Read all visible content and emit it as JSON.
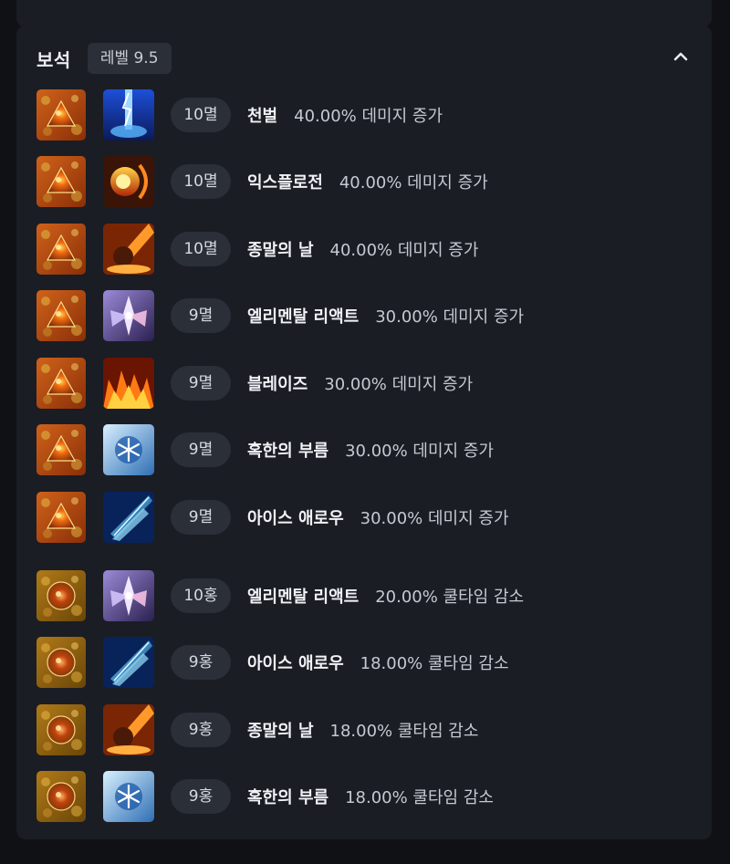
{
  "section": {
    "title": "보석",
    "level_badge": "레벨 9.5",
    "collapse_icon": "chevron-up-icon"
  },
  "colors": {
    "panel": "#1a1d24",
    "pill": "#2b2f38",
    "gem_damage_bg": "#b4490f",
    "gem_cooldown_bg": "#8a5a0a"
  },
  "gems": [
    {
      "gem_type": "damage-gem",
      "skill_icon": "judgment-lightning-icon",
      "level": "10멸",
      "skill": "천벌",
      "effect": "40.00% 데미지 증가"
    },
    {
      "gem_type": "damage-gem",
      "skill_icon": "explosion-fireball-icon",
      "level": "10멸",
      "skill": "익스플로전",
      "effect": "40.00% 데미지 증가"
    },
    {
      "gem_type": "damage-gem",
      "skill_icon": "doomsday-meteor-icon",
      "level": "10멸",
      "skill": "종말의 날",
      "effect": "40.00% 데미지 증가"
    },
    {
      "gem_type": "damage-gem",
      "skill_icon": "elemental-reaction-crystal-icon",
      "level": "9멸",
      "skill": "엘리멘탈 리액트",
      "effect": "30.00% 데미지 증가"
    },
    {
      "gem_type": "damage-gem",
      "skill_icon": "blaze-fire-icon",
      "level": "9멸",
      "skill": "블레이즈",
      "effect": "30.00% 데미지 증가"
    },
    {
      "gem_type": "damage-gem",
      "skill_icon": "frost-call-snowflake-icon",
      "level": "9멸",
      "skill": "혹한의 부름",
      "effect": "30.00% 데미지 증가"
    },
    {
      "gem_type": "damage-gem",
      "skill_icon": "ice-arrow-icon",
      "level": "9멸",
      "skill": "아이스 애로우",
      "effect": "30.00% 데미지 증가"
    },
    {
      "gem_type": "cooldown-gem",
      "skill_icon": "elemental-reaction-crystal-icon",
      "level": "10홍",
      "skill": "엘리멘탈 리액트",
      "effect": "20.00% 쿨타임 감소"
    },
    {
      "gem_type": "cooldown-gem",
      "skill_icon": "ice-arrow-icon",
      "level": "9홍",
      "skill": "아이스 애로우",
      "effect": "18.00% 쿨타임 감소"
    },
    {
      "gem_type": "cooldown-gem",
      "skill_icon": "doomsday-meteor-icon",
      "level": "9홍",
      "skill": "종말의 날",
      "effect": "18.00% 쿨타임 감소"
    },
    {
      "gem_type": "cooldown-gem",
      "skill_icon": "frost-call-snowflake-icon",
      "level": "9홍",
      "skill": "혹한의 부름",
      "effect": "18.00% 쿨타임 감소"
    }
  ]
}
